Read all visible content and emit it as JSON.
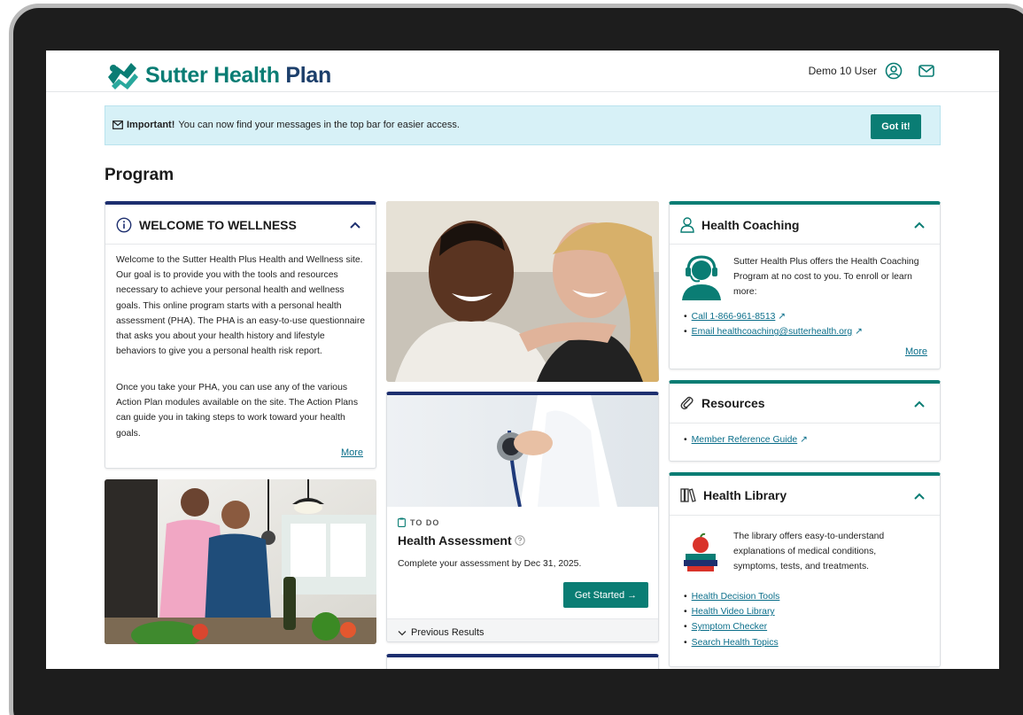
{
  "brand": {
    "name_part1": "Sutter Health",
    "name_part2": "Plan",
    "color": "#0a7d74",
    "accent": "#1c3f6b"
  },
  "header": {
    "user_name": "Demo 10 User",
    "user_icon": "user-circle-icon",
    "mail_icon": "envelope-icon"
  },
  "alert": {
    "strong": "Important!",
    "message": "You can now find your messages in the top bar for easier access.",
    "button": "Got it!",
    "bg_color": "#d7f1f7"
  },
  "page": {
    "title": "Program"
  },
  "welcome": {
    "title": "WELCOME TO WELLNESS",
    "paragraph1": "Welcome to the Sutter Health Plus Health and Wellness site.  Our goal is to provide you with the tools and resources necessary to achieve your personal health and wellness goals.  This online program starts with a personal health assessment (PHA).  The PHA is an easy-to-use questionnaire that asks you about your health history and lifestyle behaviors to give you a personal health risk report.",
    "paragraph2": "Once you take your PHA, you can use any of the various Action Plan modules available on the site.  The Action Plans can guide you in taking steps to work toward your health goals.",
    "more": "More"
  },
  "assessment": {
    "tag": "TO DO",
    "title": "Health Assessment",
    "description": "Complete your assessment by Dec 31, 2025.",
    "button": "Get Started →",
    "previous": "Previous Results"
  },
  "coaching": {
    "title": "Health Coaching",
    "description": "Sutter Health Plus offers the Health Coaching Program at no cost to you. To enroll or learn more:",
    "links": [
      "Call 1-866-961-8513",
      "Email healthcoaching@sutterhealth.org"
    ],
    "more": "More"
  },
  "resources": {
    "title": "Resources",
    "links": [
      "Member Reference Guide"
    ]
  },
  "library": {
    "title": "Health Library",
    "description": "The library offers easy-to-understand explanations of medical conditions, symptoms, tests, and treatments.",
    "links": [
      "Health Decision Tools",
      "Health Video Library",
      "Symptom Checker",
      "Search Health Topics"
    ]
  }
}
